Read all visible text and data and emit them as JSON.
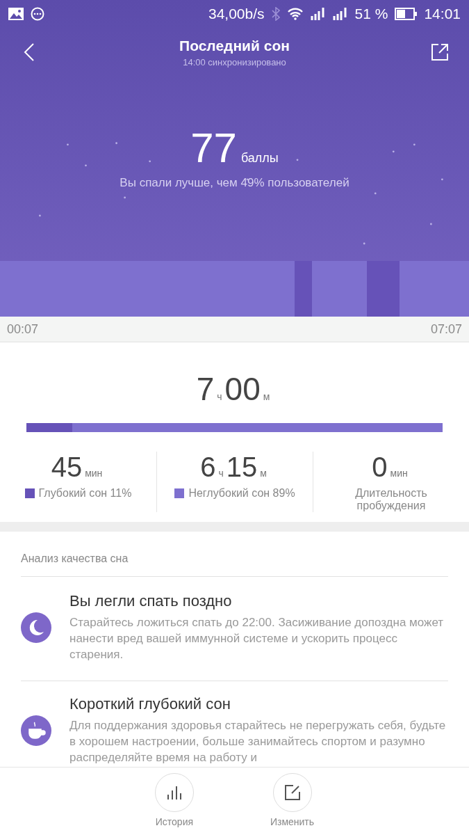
{
  "status_bar": {
    "speed": "34,00b/s",
    "battery_text": "51 %",
    "time": "14:01"
  },
  "header": {
    "title": "Последний сон",
    "subtitle": "14:00 синхронизировано"
  },
  "score": {
    "value": "77",
    "unit": "баллы",
    "comparison": "Вы спали лучше, чем 49% пользователей"
  },
  "timeline": {
    "start": "00:07",
    "end": "07:07"
  },
  "total": {
    "hours": "7",
    "hours_unit": "ч",
    "minutes": "00",
    "minutes_unit": "м",
    "level": 0.11
  },
  "stats": [
    {
      "kind": "deep",
      "parts": [
        {
          "value": "45",
          "unit": "мин"
        }
      ],
      "label": "Глубокий сон 11%"
    },
    {
      "kind": "light",
      "parts": [
        {
          "value": "6",
          "unit": "ч"
        },
        {
          "value": "15",
          "unit": "м"
        }
      ],
      "label": "Неглубокий сон 89%"
    },
    {
      "kind": "awake",
      "parts": [
        {
          "value": "0",
          "unit": "мин"
        }
      ],
      "label": "Длительность пробуждения"
    }
  ],
  "analysis": {
    "title": "Анализ качества сна",
    "items": [
      {
        "kind": "moon",
        "title": "Вы легли спать поздно",
        "text": "Старайтесь ложиться спать до 22:00. Засиживание допоздна может нанести вред вашей иммунной системе и ускорить процесс старения."
      },
      {
        "kind": "cup",
        "title": "Короткий глубокий сон",
        "text": "Для поддержания здоровья старайтесь не перегружать себя, будьте в хорошем настроении, больше занимайтесь спортом и разумно распределяйте время на работу и"
      }
    ]
  },
  "bottom_bar": [
    {
      "kind": "history",
      "label": "История"
    },
    {
      "kind": "edit",
      "label": "Изменить"
    }
  ]
}
